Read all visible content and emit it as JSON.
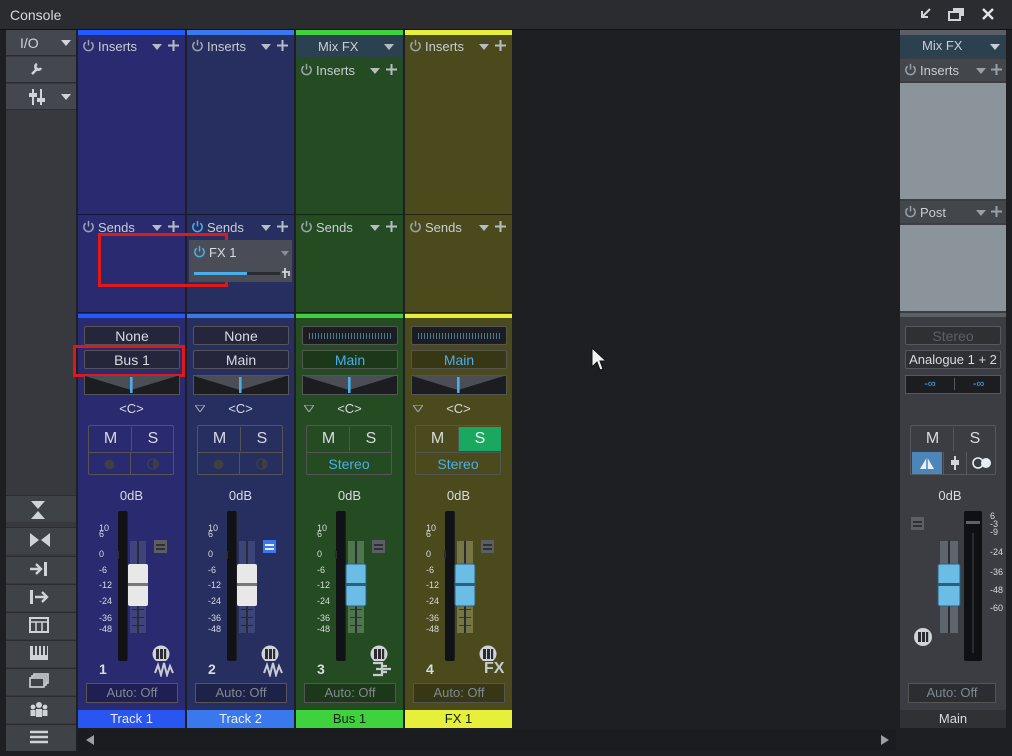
{
  "window": {
    "title": "Console"
  },
  "toolbar": {
    "io": "I/O"
  },
  "channels": [
    {
      "name": "Track 1",
      "number": "1",
      "inserts": "Inserts",
      "sends": "Sends",
      "input": "None",
      "output": "Bus 1",
      "pan": "<C>",
      "mute": "M",
      "solo": "S",
      "volume": "0dB",
      "automation": "Auto: Off",
      "type_icon": "waveform-icon",
      "color": "#1f5bff",
      "body_color": "#2a2a70",
      "name_color": "#2955f0"
    },
    {
      "name": "Track 2",
      "number": "2",
      "inserts": "Inserts",
      "sends": "Sends",
      "input": "None",
      "output": "Main",
      "pan": "<C>",
      "mute": "M",
      "solo": "S",
      "volume": "0dB",
      "automation": "Auto: Off",
      "type_icon": "waveform-icon",
      "send_name": "FX 1",
      "send_level": 0.62,
      "color": "#3a78ee",
      "body_color": "#272e60",
      "name_color": "#3a78ee"
    },
    {
      "name": "Bus 1",
      "number": "3",
      "header": "Mix FX",
      "inserts": "Inserts",
      "sends": "Sends",
      "output": "Main",
      "pan": "<C>",
      "mute": "M",
      "solo": "S",
      "mode": "Stereo",
      "volume": "0dB",
      "automation": "Auto: Off",
      "type_icon": "bus-icon",
      "color": "#3fd23f",
      "body_color": "#254b22",
      "name_color": "#3fd23f"
    },
    {
      "name": "FX 1",
      "number": "4",
      "inserts": "Inserts",
      "sends": "Sends",
      "output": "Main",
      "pan": "<C>",
      "mute": "M",
      "solo": "S",
      "mode": "Stereo",
      "volume": "0dB",
      "automation": "Auto: Off",
      "type_icon": "fx-label",
      "type_text": "FX",
      "color": "#e6ef3a",
      "body_color": "#4a4a1c",
      "name_color": "#e6ef3a"
    }
  ],
  "main": {
    "header": "Mix FX",
    "inserts": "Inserts",
    "post": "Post",
    "input": "Stereo",
    "output": "Analogue 1 + 2",
    "meter_left": "-∞",
    "meter_right": "-∞",
    "mute": "M",
    "solo": "S",
    "volume": "0dB",
    "automation": "Auto: Off",
    "name": "Main"
  },
  "scales": {
    "fader": [
      "10",
      "6",
      "0",
      "-6",
      "-12",
      "-24",
      "-36",
      "-48"
    ],
    "main_meter": [
      "6",
      "-3",
      "-9",
      "-24",
      "-36",
      "-48",
      "-60"
    ]
  },
  "colors": {
    "mix_fx_header": "#2c4150",
    "solo_active": "#1aa860",
    "accent_blue": "#4aaeea"
  }
}
